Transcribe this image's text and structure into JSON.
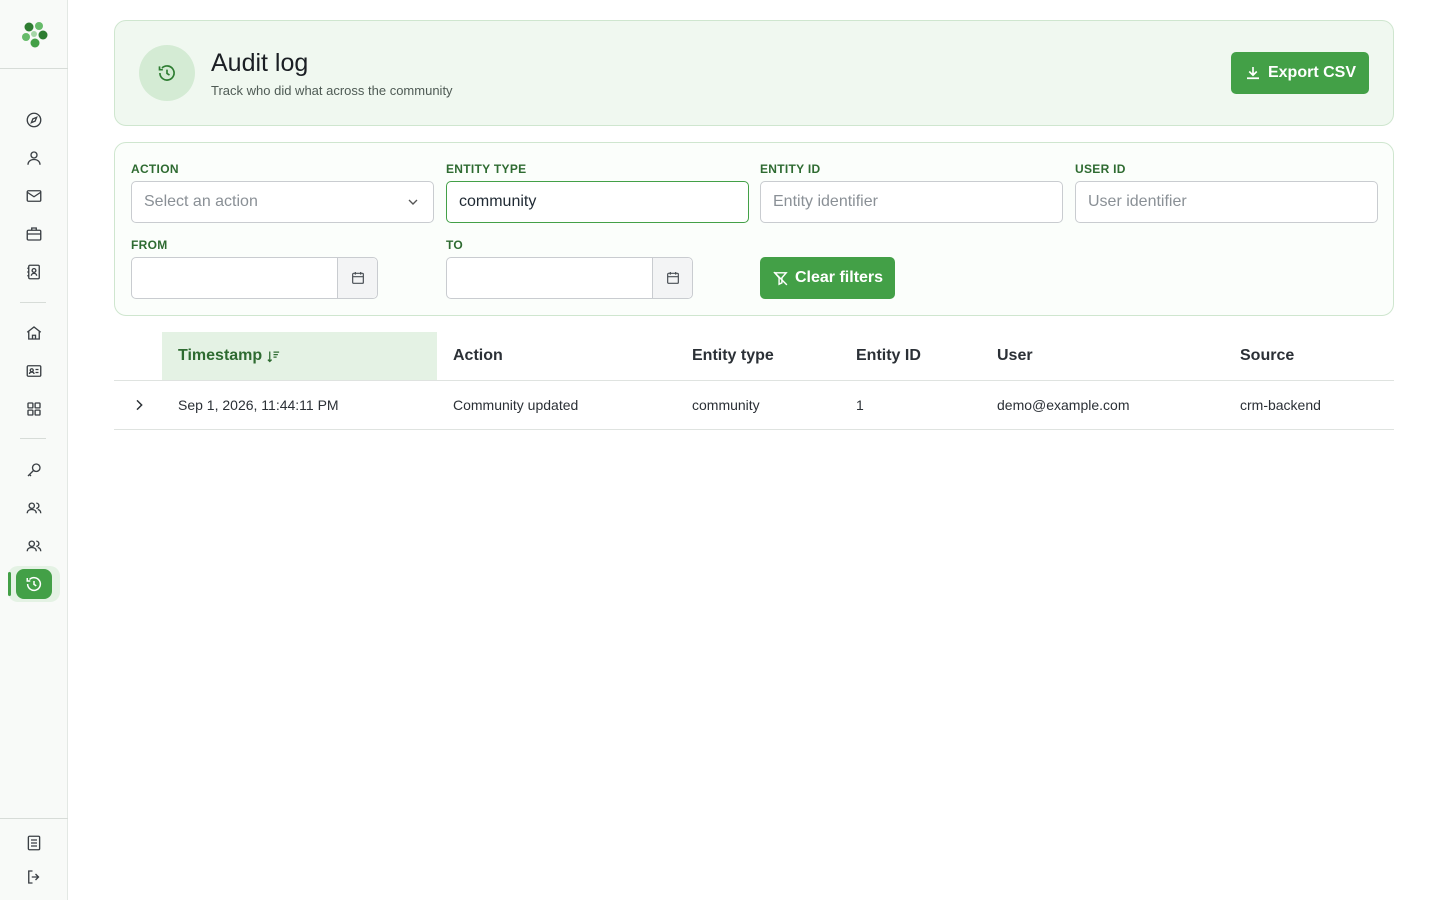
{
  "header": {
    "title": "Audit log",
    "subtitle": "Track who did what across the community",
    "export_label": "Export CSV"
  },
  "filters": {
    "action": {
      "label": "ACTION",
      "placeholder": "Select an action"
    },
    "entity_type": {
      "label": "ENTITY TYPE",
      "value": "community"
    },
    "entity_id": {
      "label": "ENTITY ID",
      "placeholder": "Entity identifier"
    },
    "user_id": {
      "label": "USER ID",
      "placeholder": "User identifier"
    },
    "from": {
      "label": "FROM"
    },
    "to": {
      "label": "TO"
    },
    "clear_label": "Clear filters"
  },
  "table": {
    "columns": [
      "Timestamp",
      "Action",
      "Entity type",
      "Entity ID",
      "User",
      "Source"
    ],
    "rows": [
      {
        "timestamp": "Sep 1, 2026, 11:44:11 PM",
        "action": "Community updated",
        "entity_type": "community",
        "entity_id": "1",
        "user": "demo@example.com",
        "source": "crm-backend"
      }
    ]
  },
  "colors": {
    "accent": "#43a047",
    "accent_light": "#e4f2e4",
    "header_bg": "#f0f8f0"
  }
}
